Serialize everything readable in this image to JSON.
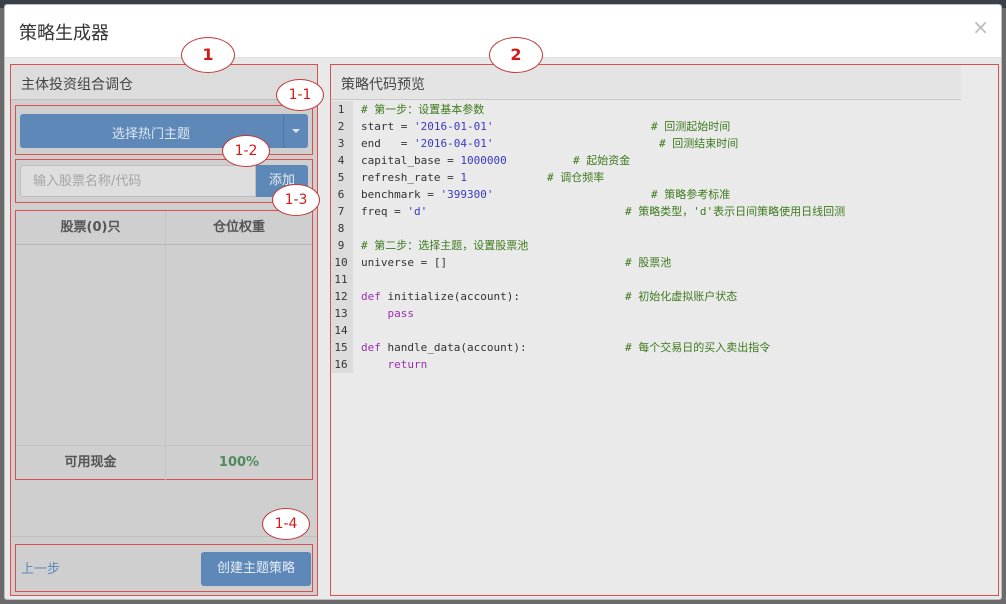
{
  "modal": {
    "title": "策略生成器",
    "close_icon": "×"
  },
  "left_panel": {
    "title": "主体投资组合调仓",
    "theme_button_label": "选择热门主题",
    "stock_input_placeholder": "输入股票名称/代码",
    "add_button_label": "添加",
    "table": {
      "headers": [
        "股票(0)只",
        "仓位权重"
      ],
      "footer_label": "可用现金",
      "footer_value": "100%"
    },
    "prev_link_label": "上一步",
    "create_button_label": "创建主题策略"
  },
  "right_panel": {
    "title": "策略代码预览"
  },
  "callouts": {
    "c1": "1",
    "c2": "2",
    "c11": "1-1",
    "c12": "1-2",
    "c13": "1-3",
    "c14": "1-4"
  },
  "code_lines": [
    {
      "n": "1",
      "code": "# 第一步：设置基本参数",
      "comment": ""
    },
    {
      "n": "2",
      "code": "start = '2016-01-01'",
      "comment": "# 回测起始时间"
    },
    {
      "n": "3",
      "code": "end   = '2016-04-01'",
      "comment": "# 回测结束时间"
    },
    {
      "n": "4",
      "code": "capital_base = 1000000",
      "comment": "# 起始资金"
    },
    {
      "n": "5",
      "code": "refresh_rate = 1",
      "comment": "# 调仓频率"
    },
    {
      "n": "6",
      "code": "benchmark = '399300'",
      "comment": "# 策略参考标准"
    },
    {
      "n": "7",
      "code": "freq = 'd'",
      "comment": "# 策略类型，'d'表示日间策略使用日线回测"
    },
    {
      "n": "8",
      "code": "",
      "comment": ""
    },
    {
      "n": "9",
      "code": "# 第二步：选择主题，设置股票池",
      "comment": ""
    },
    {
      "n": "10",
      "code": "universe = []",
      "comment": "# 股票池"
    },
    {
      "n": "11",
      "code": "",
      "comment": ""
    },
    {
      "n": "12",
      "code": "def initialize(account):",
      "comment": "# 初始化虚拟账户状态"
    },
    {
      "n": "13",
      "code": "    pass",
      "comment": ""
    },
    {
      "n": "14",
      "code": "",
      "comment": ""
    },
    {
      "n": "15",
      "code": "def handle_data(account):",
      "comment": "# 每个交易日的买入卖出指令"
    },
    {
      "n": "16",
      "code": "    return",
      "comment": ""
    }
  ]
}
